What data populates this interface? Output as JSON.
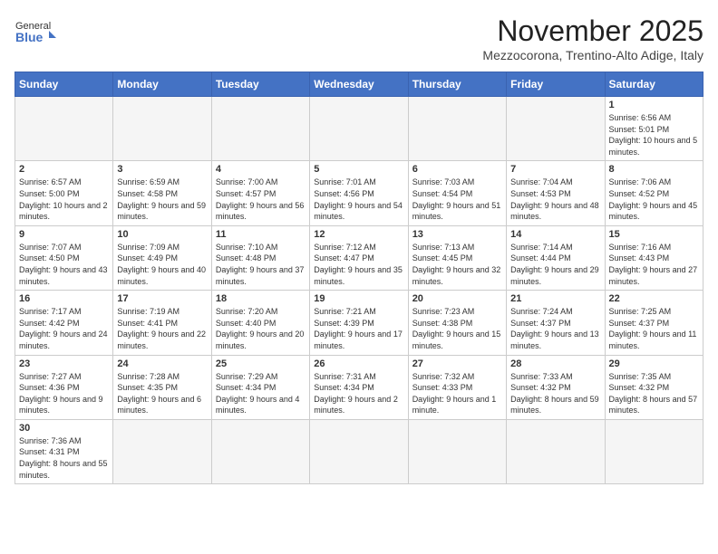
{
  "header": {
    "logo_text_regular": "General",
    "logo_text_bold": "Blue",
    "month_title": "November 2025",
    "location": "Mezzocorona, Trentino-Alto Adige, Italy"
  },
  "weekdays": [
    "Sunday",
    "Monday",
    "Tuesday",
    "Wednesday",
    "Thursday",
    "Friday",
    "Saturday"
  ],
  "weeks": [
    [
      {
        "day": "",
        "info": ""
      },
      {
        "day": "",
        "info": ""
      },
      {
        "day": "",
        "info": ""
      },
      {
        "day": "",
        "info": ""
      },
      {
        "day": "",
        "info": ""
      },
      {
        "day": "",
        "info": ""
      },
      {
        "day": "1",
        "info": "Sunrise: 6:56 AM\nSunset: 5:01 PM\nDaylight: 10 hours and 5 minutes."
      }
    ],
    [
      {
        "day": "2",
        "info": "Sunrise: 6:57 AM\nSunset: 5:00 PM\nDaylight: 10 hours and 2 minutes."
      },
      {
        "day": "3",
        "info": "Sunrise: 6:59 AM\nSunset: 4:58 PM\nDaylight: 9 hours and 59 minutes."
      },
      {
        "day": "4",
        "info": "Sunrise: 7:00 AM\nSunset: 4:57 PM\nDaylight: 9 hours and 56 minutes."
      },
      {
        "day": "5",
        "info": "Sunrise: 7:01 AM\nSunset: 4:56 PM\nDaylight: 9 hours and 54 minutes."
      },
      {
        "day": "6",
        "info": "Sunrise: 7:03 AM\nSunset: 4:54 PM\nDaylight: 9 hours and 51 minutes."
      },
      {
        "day": "7",
        "info": "Sunrise: 7:04 AM\nSunset: 4:53 PM\nDaylight: 9 hours and 48 minutes."
      },
      {
        "day": "8",
        "info": "Sunrise: 7:06 AM\nSunset: 4:52 PM\nDaylight: 9 hours and 45 minutes."
      }
    ],
    [
      {
        "day": "9",
        "info": "Sunrise: 7:07 AM\nSunset: 4:50 PM\nDaylight: 9 hours and 43 minutes."
      },
      {
        "day": "10",
        "info": "Sunrise: 7:09 AM\nSunset: 4:49 PM\nDaylight: 9 hours and 40 minutes."
      },
      {
        "day": "11",
        "info": "Sunrise: 7:10 AM\nSunset: 4:48 PM\nDaylight: 9 hours and 37 minutes."
      },
      {
        "day": "12",
        "info": "Sunrise: 7:12 AM\nSunset: 4:47 PM\nDaylight: 9 hours and 35 minutes."
      },
      {
        "day": "13",
        "info": "Sunrise: 7:13 AM\nSunset: 4:45 PM\nDaylight: 9 hours and 32 minutes."
      },
      {
        "day": "14",
        "info": "Sunrise: 7:14 AM\nSunset: 4:44 PM\nDaylight: 9 hours and 29 minutes."
      },
      {
        "day": "15",
        "info": "Sunrise: 7:16 AM\nSunset: 4:43 PM\nDaylight: 9 hours and 27 minutes."
      }
    ],
    [
      {
        "day": "16",
        "info": "Sunrise: 7:17 AM\nSunset: 4:42 PM\nDaylight: 9 hours and 24 minutes."
      },
      {
        "day": "17",
        "info": "Sunrise: 7:19 AM\nSunset: 4:41 PM\nDaylight: 9 hours and 22 minutes."
      },
      {
        "day": "18",
        "info": "Sunrise: 7:20 AM\nSunset: 4:40 PM\nDaylight: 9 hours and 20 minutes."
      },
      {
        "day": "19",
        "info": "Sunrise: 7:21 AM\nSunset: 4:39 PM\nDaylight: 9 hours and 17 minutes."
      },
      {
        "day": "20",
        "info": "Sunrise: 7:23 AM\nSunset: 4:38 PM\nDaylight: 9 hours and 15 minutes."
      },
      {
        "day": "21",
        "info": "Sunrise: 7:24 AM\nSunset: 4:37 PM\nDaylight: 9 hours and 13 minutes."
      },
      {
        "day": "22",
        "info": "Sunrise: 7:25 AM\nSunset: 4:37 PM\nDaylight: 9 hours and 11 minutes."
      }
    ],
    [
      {
        "day": "23",
        "info": "Sunrise: 7:27 AM\nSunset: 4:36 PM\nDaylight: 9 hours and 9 minutes."
      },
      {
        "day": "24",
        "info": "Sunrise: 7:28 AM\nSunset: 4:35 PM\nDaylight: 9 hours and 6 minutes."
      },
      {
        "day": "25",
        "info": "Sunrise: 7:29 AM\nSunset: 4:34 PM\nDaylight: 9 hours and 4 minutes."
      },
      {
        "day": "26",
        "info": "Sunrise: 7:31 AM\nSunset: 4:34 PM\nDaylight: 9 hours and 2 minutes."
      },
      {
        "day": "27",
        "info": "Sunrise: 7:32 AM\nSunset: 4:33 PM\nDaylight: 9 hours and 1 minute."
      },
      {
        "day": "28",
        "info": "Sunrise: 7:33 AM\nSunset: 4:32 PM\nDaylight: 8 hours and 59 minutes."
      },
      {
        "day": "29",
        "info": "Sunrise: 7:35 AM\nSunset: 4:32 PM\nDaylight: 8 hours and 57 minutes."
      }
    ],
    [
      {
        "day": "30",
        "info": "Sunrise: 7:36 AM\nSunset: 4:31 PM\nDaylight: 8 hours and 55 minutes."
      },
      {
        "day": "",
        "info": ""
      },
      {
        "day": "",
        "info": ""
      },
      {
        "day": "",
        "info": ""
      },
      {
        "day": "",
        "info": ""
      },
      {
        "day": "",
        "info": ""
      },
      {
        "day": "",
        "info": ""
      }
    ]
  ]
}
